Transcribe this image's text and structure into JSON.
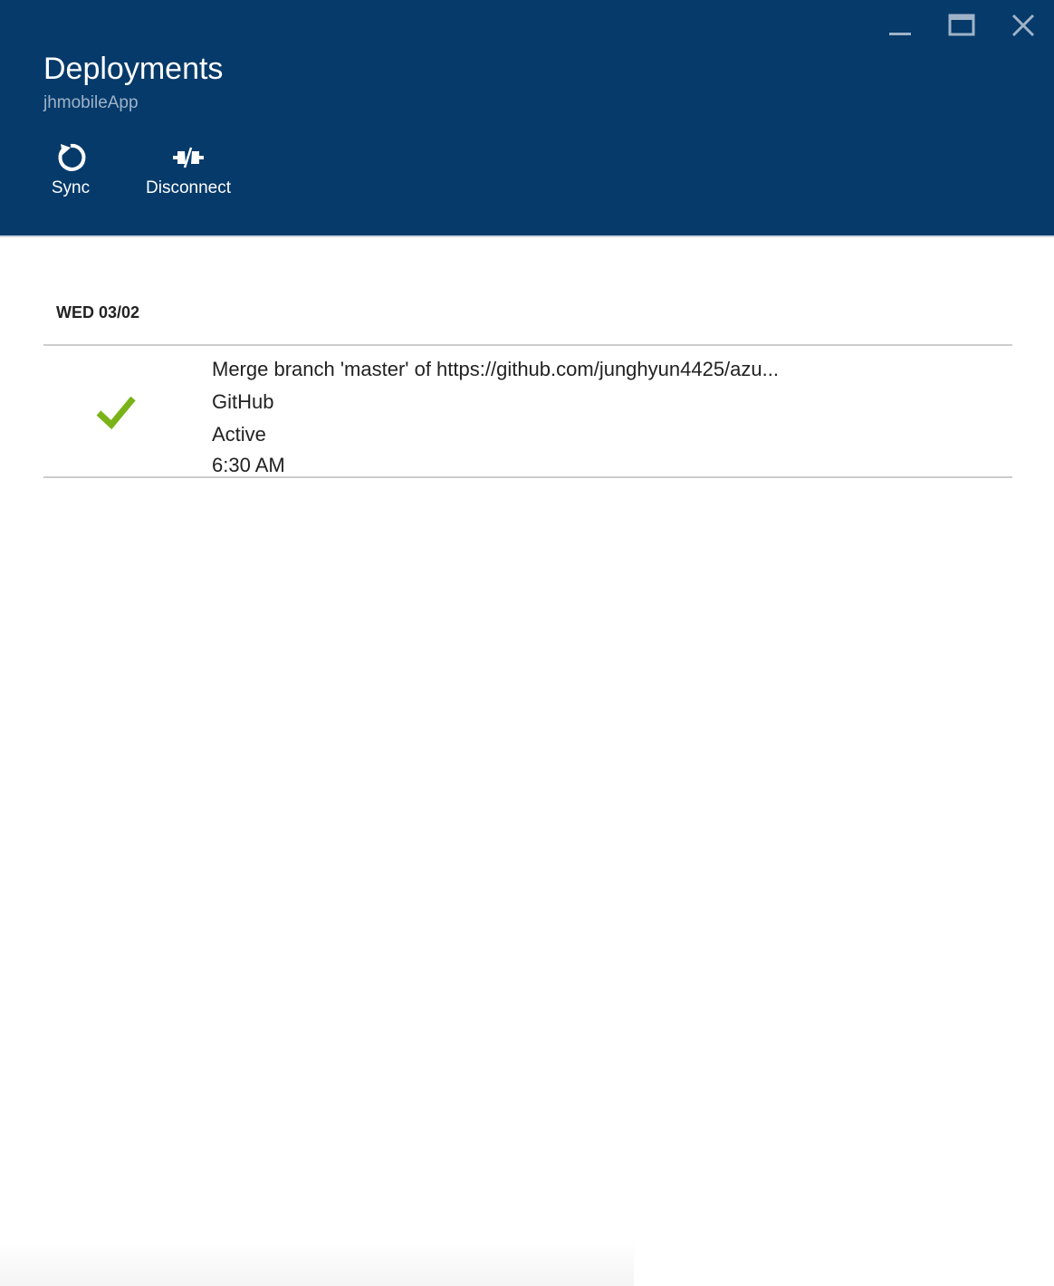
{
  "blade": {
    "title": "Deployments",
    "subtitle": "jhmobileApp"
  },
  "window_controls": {
    "minimize_icon": "minimize-icon",
    "maximize_icon": "maximize-icon",
    "close_icon": "close-icon"
  },
  "toolbar": {
    "sync_label": "Sync",
    "sync_icon": "refresh-icon",
    "disconnect_label": "Disconnect",
    "disconnect_icon": "disconnect-plug-icon"
  },
  "deployments": {
    "group_date": "WED 03/02",
    "items": [
      {
        "status_icon": "checkmark-icon",
        "message": "Merge branch 'master' of https://github.com/junghyun4425/azu...",
        "source": "GitHub",
        "state": "Active",
        "time": "6:30 AM"
      }
    ]
  },
  "colors": {
    "header_bg": "#053a6a",
    "subtitle": "#9fb3c8",
    "success": "#7ab317",
    "text": "#222222",
    "divider": "#cccccc"
  }
}
